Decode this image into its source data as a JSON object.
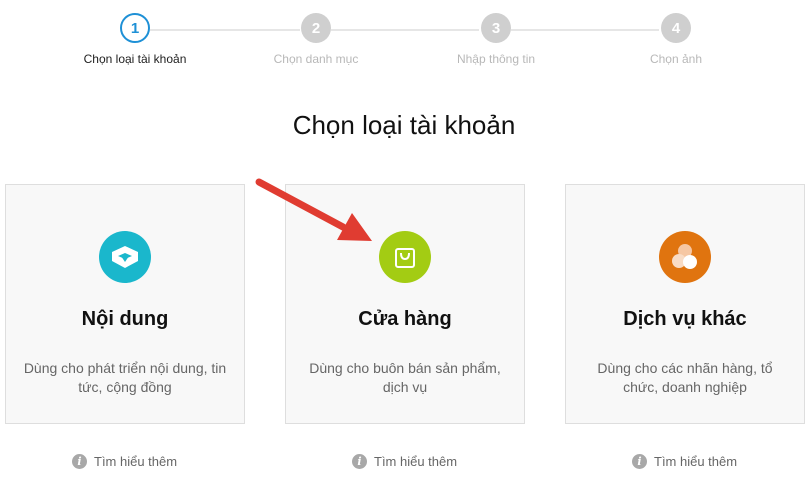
{
  "stepper": {
    "steps": [
      {
        "number": "1",
        "label": "Chọn loại tài khoản",
        "active": true
      },
      {
        "number": "2",
        "label": "Chọn danh mục",
        "active": false
      },
      {
        "number": "3",
        "label": "Nhập thông tin",
        "active": false
      },
      {
        "number": "4",
        "label": "Chọn ảnh",
        "active": false
      }
    ]
  },
  "title": "Chọn loại tài khoản",
  "cards": [
    {
      "title": "Nội dung",
      "description": "Dùng cho phát triển nội dung, tin tức, cộng đồng",
      "icon": "content-icon",
      "color": "#1ab7cc"
    },
    {
      "title": "Cửa hàng",
      "description": "Dùng cho buôn bán sản phẩm, dịch vụ",
      "icon": "shopping-bag-icon",
      "color": "#a3cc13"
    },
    {
      "title": "Dịch vụ khác",
      "description": "Dùng cho các nhãn hàng, tổ chức, doanh nghiệp",
      "icon": "services-icon",
      "color": "#e0740f"
    }
  ],
  "learn_more": {
    "label": "Tìm hiểu thêm",
    "icon": "info-icon"
  },
  "colors": {
    "active_step": "#1e90d6",
    "inactive_step": "#cfcfcf",
    "arrow": "#e03c31"
  }
}
